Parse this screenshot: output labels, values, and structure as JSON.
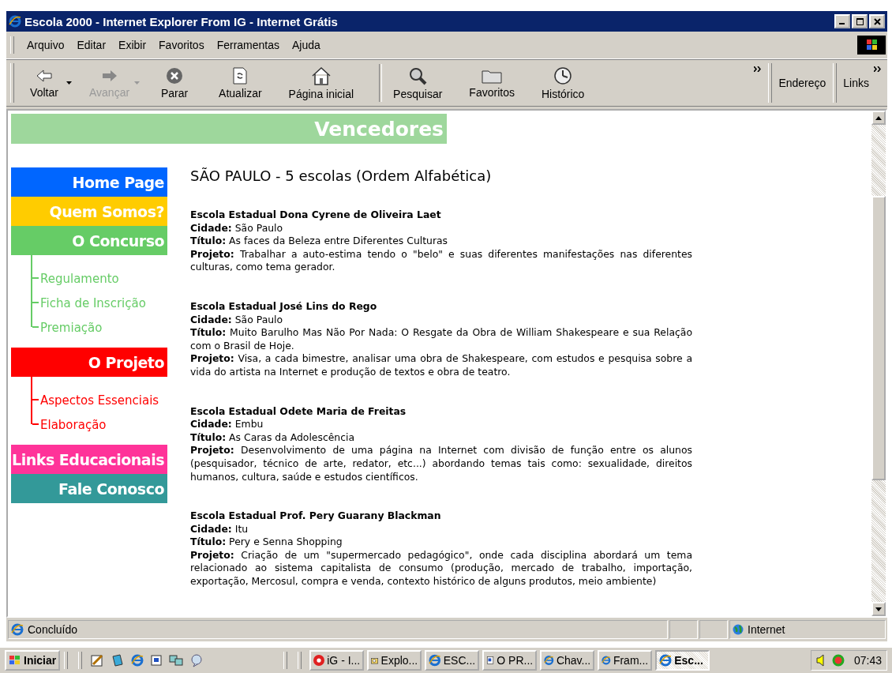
{
  "window": {
    "title": "Escola 2000 - Internet Explorer From IG - Internet Grátis"
  },
  "menu": [
    "Arquivo",
    "Editar",
    "Exibir",
    "Favoritos",
    "Ferramentas",
    "Ajuda"
  ],
  "toolbar": [
    {
      "kind": "back",
      "label": "Voltar",
      "disabled": false
    },
    {
      "kind": "forward",
      "label": "Avançar",
      "disabled": true
    },
    {
      "kind": "stop",
      "label": "Parar",
      "disabled": false
    },
    {
      "kind": "refresh",
      "label": "Atualizar",
      "disabled": false
    },
    {
      "kind": "home",
      "label": "Página inicial",
      "disabled": false
    },
    {
      "kind": "search",
      "label": "Pesquisar",
      "disabled": false
    },
    {
      "kind": "favorites",
      "label": "Favoritos",
      "disabled": false
    },
    {
      "kind": "history",
      "label": "Histórico",
      "disabled": false
    }
  ],
  "address_label": "Endereço",
  "links_label": "Links",
  "page": {
    "banner": "Vencedores",
    "nav": [
      {
        "label": "Home Page",
        "color": "#0066ff"
      },
      {
        "label": "Quem Somos?",
        "color": "#ffcc00"
      },
      {
        "label": "O Concurso",
        "color": "#66cc66",
        "children": [
          {
            "label": "Regulamento"
          },
          {
            "label": "Ficha de Inscrição"
          },
          {
            "label": "Premiação"
          }
        ]
      },
      {
        "label": "O Projeto",
        "color": "#ff0000",
        "children": [
          {
            "label": "Aspectos Essenciais"
          },
          {
            "label": "Elaboração"
          }
        ]
      },
      {
        "label": "Links Educacionais",
        "color": "#ff3399"
      },
      {
        "label": "Fale Conosco",
        "color": "#339999"
      }
    ],
    "heading": "SÃO PAULO - 5 escolas (Ordem Alfabética)",
    "schools": [
      {
        "name": "Escola Estadual Dona Cyrene de Oliveira Laet",
        "city": "**Cidade:** São Paulo",
        "title": "**Título:** As faces da Beleza entre Diferentes Culturas",
        "project": "**Projeto:** Trabalhar a auto-estima tendo o \"belo\" e suas diferentes manifestações nas diferentes culturas, como tema gerador."
      },
      {
        "name": "Escola Estadual José Lins do Rego",
        "city": "**Cidade:** São Paulo",
        "title": "**Título:** Muito Barulho Mas Não Por Nada: O Resgate da Obra de William Shakespeare e sua Relação com o Brasil de Hoje.",
        "project": "**Projeto:** Visa, a cada bimestre, analisar uma obra de Shakespeare, com estudos e pesquisa sobre a vida do artista na Internet e produção de textos e obra de teatro."
      },
      {
        "name": "Escola Estadual Odete Maria de Freitas",
        "city": "**Cidade:** Embu",
        "title": "**Título:** As Caras da Adolescência",
        "project": "**Projeto:** Desenvolvimento de uma página na Internet com divisão de função entre os alunos (pesquisador, técnico de arte, redator, etc...) abordando temas tais como: sexualidade, direitos humanos, cultura, saúde e estudos científicos."
      },
      {
        "name": "Escola Estadual Prof. Pery Guarany Blackman",
        "city": "**Cidade:** Itu",
        "title": "**Título:** Pery e Senna Shopping",
        "project": "**Projeto:** Criação de um \"supermercado pedagógico\", onde cada disciplina abordará um tema relacionado ao sistema capitalista de consumo (produção, mercado de trabalho, importação, exportação, Mercosul, compra e venda, contexto histórico de alguns produtos, meio ambiente)"
      }
    ]
  },
  "status_bar": {
    "text": "Concluído",
    "zone": "Internet"
  },
  "taskbar": {
    "start": "Iniciar",
    "tasks": [
      {
        "kind": "ig",
        "label": "iG - I...",
        "selected": false
      },
      {
        "kind": "explorer",
        "label": "Explo...",
        "selected": false
      },
      {
        "kind": "ie",
        "label": "ESC...",
        "selected": false
      },
      {
        "kind": "word",
        "label": "O PR...",
        "selected": false
      },
      {
        "kind": "ie",
        "label": "Chav...",
        "selected": false
      },
      {
        "kind": "ie",
        "label": "Fram...",
        "selected": false
      },
      {
        "kind": "ie",
        "label": "Esc...",
        "selected": true
      }
    ],
    "clock": "07:43"
  }
}
